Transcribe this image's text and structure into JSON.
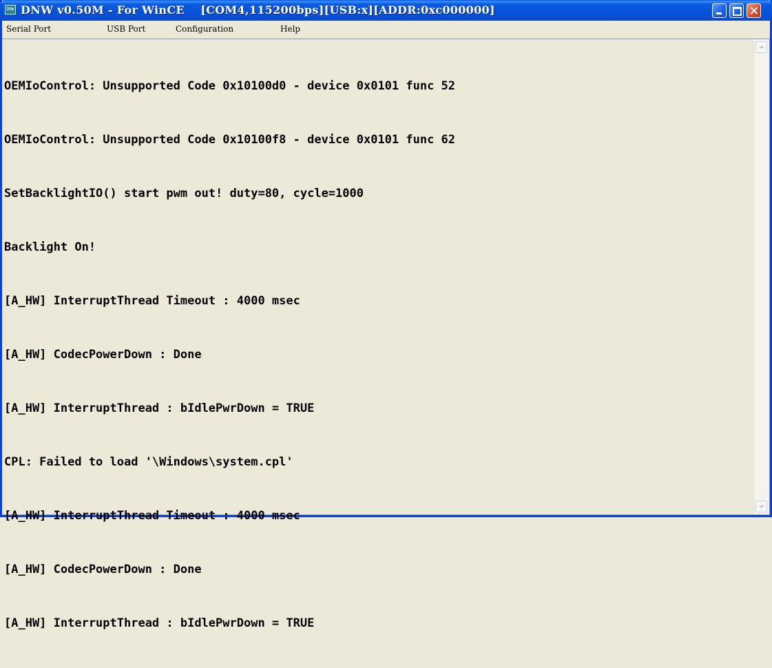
{
  "window": {
    "title": "DNW v0.50M - For WinCE    [COM4,115200bps][USB:x][ADDR:0xc000000]",
    "icon_name": "dnw-app-icon",
    "icon_text": "DNW",
    "title_color": "#0651d8"
  },
  "menu": {
    "items": [
      {
        "label": "Serial Port"
      },
      {
        "label": "USB Port"
      },
      {
        "label": "Configuration"
      },
      {
        "label": "Help"
      }
    ]
  },
  "console": {
    "lines": [
      "OEMIoControl: Unsupported Code 0x10100d0 - device 0x0101 func 52",
      "OEMIoControl: Unsupported Code 0x10100f8 - device 0x0101 func 62",
      "SetBacklightIO() start pwm out! duty=80, cycle=1000",
      "Backlight On!",
      "[A_HW] InterruptThread Timeout : 4000 msec",
      "[A_HW] CodecPowerDown : Done",
      "[A_HW] InterruptThread : bIdlePwrDown = TRUE",
      "CPL: Failed to load '\\Windows\\system.cpl'",
      "[A_HW] InterruptThread Timeout : 4000 msec",
      "[A_HW] CodecPowerDown : Done",
      "[A_HW] InterruptThread : bIdlePwrDown = TRUE"
    ]
  }
}
